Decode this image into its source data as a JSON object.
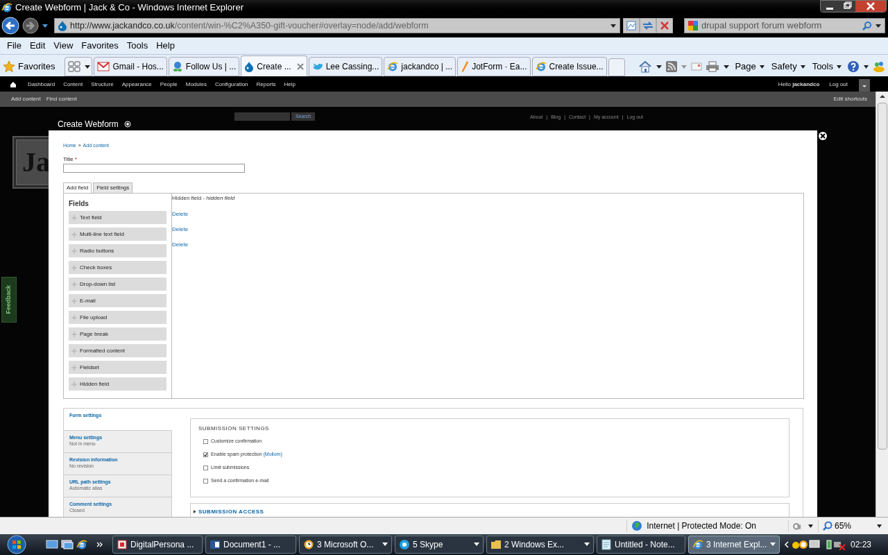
{
  "window": {
    "title": "Create Webform | Jack & Co - Windows Internet Explorer"
  },
  "address": {
    "url_host": "http://www.jackandco.co.uk",
    "url_path": "/content/win-%C2%A350-gift-voucher#overlay=node/add/webform",
    "search": "drupal support forum webform"
  },
  "menu": [
    "File",
    "Edit",
    "View",
    "Favorites",
    "Tools",
    "Help"
  ],
  "favorites": {
    "label": "Favorites"
  },
  "tabs": [
    {
      "label": "Gmail - Hos...",
      "selected": false
    },
    {
      "label": "Follow Us | ...",
      "selected": false
    },
    {
      "label": "Create ...",
      "selected": true
    },
    {
      "label": "Lee Cassing...",
      "selected": false
    },
    {
      "label": "jackandco | ...",
      "selected": false
    },
    {
      "label": "JotForm · Ea...",
      "selected": false
    },
    {
      "label": "Create Issue...",
      "selected": false
    }
  ],
  "command_bar": [
    "Page",
    "Safety",
    "Tools"
  ],
  "admin_toolbar": {
    "items": [
      "Dashboard",
      "Content",
      "Structure",
      "Appearance",
      "People",
      "Modules",
      "Configuration",
      "Reports",
      "Help"
    ],
    "greeting": "Hello",
    "user": "jackandco",
    "logout": "Log out"
  },
  "shortcuts": {
    "items": [
      "Add content",
      "Find content"
    ],
    "edit": "Edit shortcuts"
  },
  "site": {
    "search_button": "Search",
    "links": [
      "About",
      "Blog",
      "Contact",
      "My account",
      "Log out"
    ],
    "separators": [
      "|",
      "|",
      "|",
      "|"
    ],
    "logo_text": "Ja",
    "feedback": "Feedback"
  },
  "overlay": {
    "title": "Create Webform",
    "breadcrumb": [
      "Home",
      "Add content"
    ],
    "breadcrumb_separators": [
      "»"
    ],
    "title_label": "Title",
    "required_mark": "*",
    "tabs": [
      {
        "label": "Add field",
        "selected": true
      },
      {
        "label": "Field settings",
        "selected": false
      }
    ],
    "fields_heading": "Fields",
    "field_types": [
      "Text field",
      "Multi-line text field",
      "Radio buttons",
      "Check boxes",
      "Drop-down list",
      "E-mail",
      "File upload",
      "Page break",
      "Formatted content",
      "Fieldset",
      "Hidden field"
    ],
    "canvas": {
      "first_field": "Hidden field - *hidden field*",
      "links": [
        "Delete",
        "Delete",
        "Delete"
      ]
    },
    "vertical_tabs": [
      {
        "title": "Form settings",
        "selected": true
      },
      {
        "title": "Menu settings",
        "summary": "Not in menu",
        "selected": false
      },
      {
        "title": "Revision information",
        "summary": "No revision",
        "selected": false
      },
      {
        "title": "URL path settings",
        "summary": "Automatic alias",
        "selected": false
      },
      {
        "title": "Comment settings",
        "summary": "Closed",
        "selected": false
      }
    ],
    "submission_settings": {
      "heading": "SUBMISSION SETTINGS",
      "options": [
        {
          "label": "Customize confirmation",
          "checked": false
        },
        {
          "label": "Enable spam protection",
          "link": "(Mollom)",
          "checked": true
        },
        {
          "label": "Limit submissions",
          "checked": false
        },
        {
          "label": "Send a confirmation e-mail",
          "checked": false
        }
      ]
    },
    "submission_access": {
      "heading": "SUBMISSION ACCESS",
      "expanded": false
    }
  },
  "status_bar": {
    "zone": "Internet | Protected Mode: On",
    "zoom": "65%"
  },
  "taskbar": {
    "items": [
      {
        "label": "DigitalPersona ...",
        "selected": false
      },
      {
        "label": "Document1 - ...",
        "selected": false
      },
      {
        "label": "3 Microsoft O...",
        "selected": false
      },
      {
        "label": "5 Skype",
        "selected": false
      },
      {
        "label": "2 Windows Ex...",
        "selected": false
      },
      {
        "label": "Untitled - Note...",
        "selected": false
      },
      {
        "label": "3 Internet Expl...",
        "selected": true
      }
    ],
    "time": "02:23"
  }
}
